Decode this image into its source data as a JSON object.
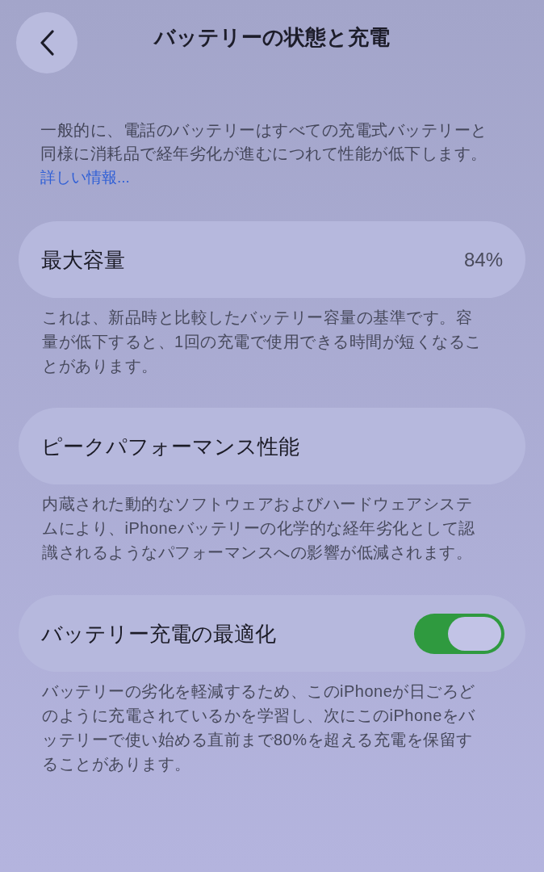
{
  "nav": {
    "title": "バッテリーの状態と充電"
  },
  "intro": {
    "text": "一般的に、電話のバッテリーはすべての充電式バッテリーと同様に消耗品で経年劣化が進むにつれて性能が低下します。",
    "link": "詳しい情報..."
  },
  "sections": [
    {
      "kind": "value",
      "label": "最大容量",
      "value": "84%",
      "footer": "これは、新品時と比較したバッテリー容量の基準です。容量が低下すると、1回の充電で使用できる時間が短くなることがあります。"
    },
    {
      "kind": "plain",
      "label": "ピークパフォーマンス性能",
      "footer": "内蔵された動的なソフトウェアおよびハードウェアシステムにより、iPhoneバッテリーの化学的な経年劣化として認識されるようなパフォーマンスへの影響が低減されます。"
    },
    {
      "kind": "toggle",
      "label": "バッテリー充電の最適化",
      "on": true,
      "footer": "バッテリーの劣化を軽減するため、このiPhoneが日ごろどのように充電されているかを学習し、次にこのiPhoneをバッテリーで使い始める直前まで80%を超える充電を保留することがあります。"
    }
  ]
}
